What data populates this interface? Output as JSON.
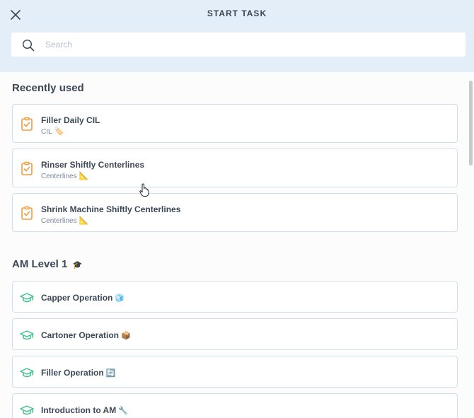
{
  "header": {
    "title": "START TASK",
    "search_placeholder": "Search"
  },
  "sections": {
    "recent": {
      "title": "Recently used",
      "items": [
        {
          "title": "Filler Daily CIL",
          "sub": "CIL",
          "emoji": "🏷️"
        },
        {
          "title": "Rinser Shiftly Centerlines",
          "sub": "Centerlines",
          "emoji": "📐"
        },
        {
          "title": "Shrink Machine Shiftly Centerlines",
          "sub": "Centerlines",
          "emoji": "📐"
        }
      ]
    },
    "am": {
      "title": "AM Level 1",
      "emoji": "🎓",
      "items": [
        {
          "title": "Capper Operation",
          "emoji": "🧊"
        },
        {
          "title": "Cartoner Operation",
          "emoji": "📦"
        },
        {
          "title": "Filler Operation",
          "emoji": "🔄"
        },
        {
          "title": "Introduction to AM",
          "emoji": "🔧"
        }
      ]
    }
  },
  "colors": {
    "header_bg": "#e3eef8",
    "clipboard_icon": "#f09a3e",
    "graduation_icon": "#3cc48a",
    "card_border": "#cfdff0"
  },
  "icons": {
    "close": "close-icon",
    "search": "search-icon",
    "task": "clipboard-check-icon",
    "course": "graduation-cap-icon"
  }
}
